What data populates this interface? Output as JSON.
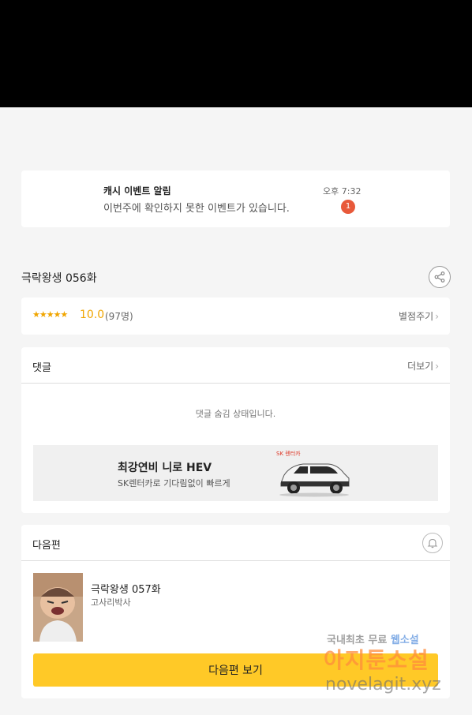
{
  "notification": {
    "title": "캐시 이벤트 알림",
    "body": "이번주에 확인하지 못한 이벤트가 있습니다.",
    "time": "오후 7:32",
    "badge": "1"
  },
  "episode": {
    "title": "극락왕생 056화",
    "share_icon": "share-icon"
  },
  "rating": {
    "stars": "★★★★★",
    "score": "10.0",
    "count": "(97명)",
    "rate_label": "별점주기",
    "chevron": "›"
  },
  "comments": {
    "title": "댓글",
    "more_label": "더보기",
    "chevron": "›",
    "hidden_text": "댓글 숨김 상태입니다."
  },
  "ad": {
    "title": "최강연비 니로 HEV",
    "subtitle": "SK렌터카로 기다림없이 빠르게",
    "logo_text": "SK 렌터카"
  },
  "next_episode": {
    "section_title": "다음편",
    "bell_icon": "bell-icon",
    "episode_title": "극락왕생 057화",
    "author": "고사리박사",
    "button_label": "다음편 보기"
  },
  "watermark": {
    "line1_a": "국내최초 무료 ",
    "line1_b": "웹소설",
    "line2": "아지툰소설",
    "line3": "novelagit.xyz"
  },
  "colors": {
    "accent": "#ffc927",
    "rating": "#f0a500",
    "badge": "#e8593a"
  }
}
